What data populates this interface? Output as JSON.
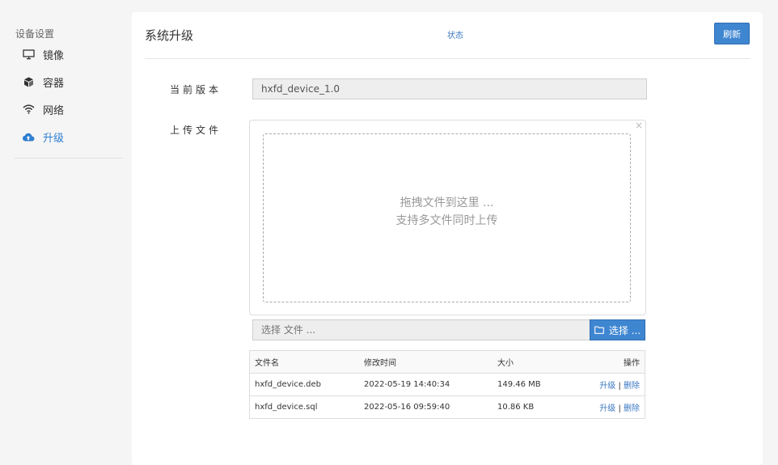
{
  "sidebar": {
    "heading": "设备设置",
    "items": [
      {
        "label": "镜像",
        "icon": "monitor-icon",
        "active": false
      },
      {
        "label": "容器",
        "icon": "cube-icon",
        "active": false
      },
      {
        "label": "网络",
        "icon": "wifi-icon",
        "active": false
      },
      {
        "label": "升级",
        "icon": "cloud-upload-icon",
        "active": true
      }
    ]
  },
  "header": {
    "title": "系统升级",
    "status_link": "状态",
    "refresh_label": "刷新"
  },
  "form": {
    "version_label": "当前版本",
    "version_value": "hxfd_device_1.0",
    "upload_label": "上传文件",
    "drop_text_1": "拖拽文件到这里 ...",
    "drop_text_2": "支持多文件同时上传",
    "file_placeholder": "选择 文件 ...",
    "browse_label": "选择 ...",
    "close_glyph": "×"
  },
  "table": {
    "headers": [
      "文件名",
      "修改时间",
      "大小",
      "操作"
    ],
    "rows": [
      {
        "name": "hxfd_device.deb",
        "mtime": "2022-05-19 14:40:34",
        "size": "149.46 MB",
        "upgrade": "升级",
        "sep": "|",
        "delete": "删除"
      },
      {
        "name": "hxfd_device.sql",
        "mtime": "2022-05-16 09:59:40",
        "size": "10.86 KB",
        "upgrade": "升级",
        "sep": "|",
        "delete": "删除"
      }
    ]
  },
  "colors": {
    "accent": "#3f86d1",
    "link": "#3a78c2",
    "active_nav": "#2f7fd0"
  }
}
